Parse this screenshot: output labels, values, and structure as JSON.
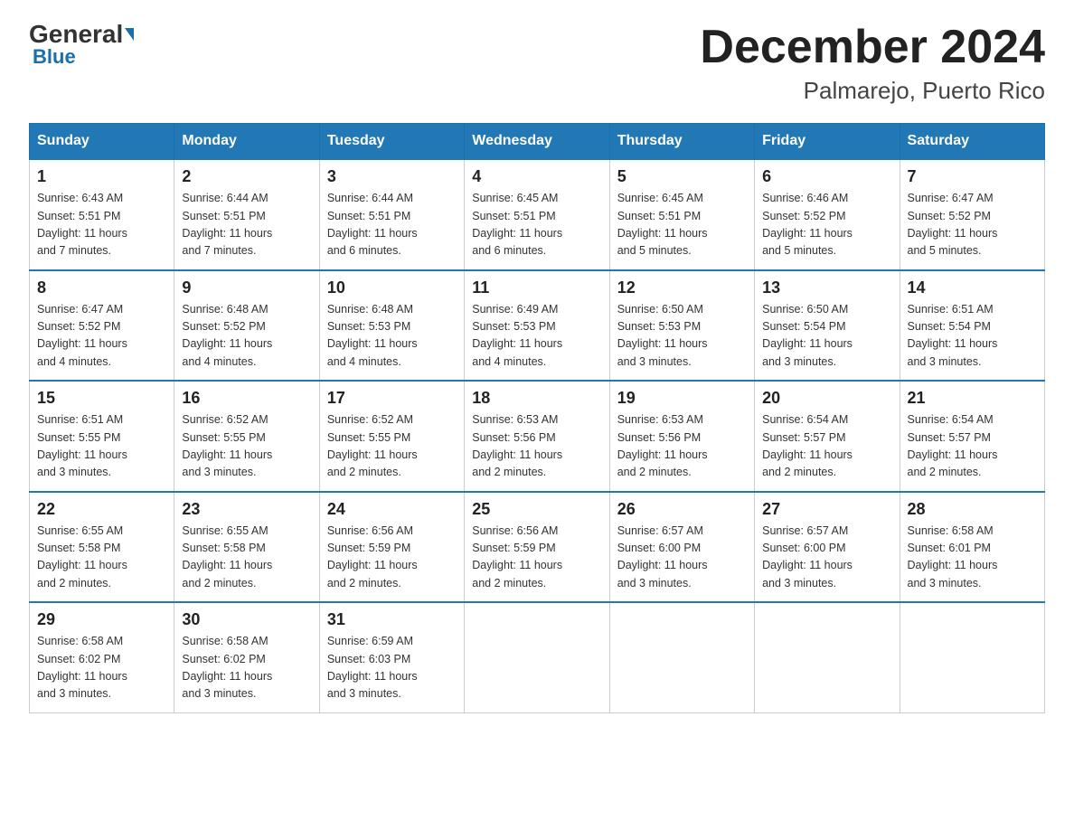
{
  "header": {
    "logo_general": "General",
    "logo_blue": "Blue",
    "month_title": "December 2024",
    "location": "Palmarejo, Puerto Rico"
  },
  "columns": [
    "Sunday",
    "Monday",
    "Tuesday",
    "Wednesday",
    "Thursday",
    "Friday",
    "Saturday"
  ],
  "weeks": [
    [
      {
        "day": "1",
        "sunrise": "6:43 AM",
        "sunset": "5:51 PM",
        "daylight": "11 hours and 7 minutes."
      },
      {
        "day": "2",
        "sunrise": "6:44 AM",
        "sunset": "5:51 PM",
        "daylight": "11 hours and 7 minutes."
      },
      {
        "day": "3",
        "sunrise": "6:44 AM",
        "sunset": "5:51 PM",
        "daylight": "11 hours and 6 minutes."
      },
      {
        "day": "4",
        "sunrise": "6:45 AM",
        "sunset": "5:51 PM",
        "daylight": "11 hours and 6 minutes."
      },
      {
        "day": "5",
        "sunrise": "6:45 AM",
        "sunset": "5:51 PM",
        "daylight": "11 hours and 5 minutes."
      },
      {
        "day": "6",
        "sunrise": "6:46 AM",
        "sunset": "5:52 PM",
        "daylight": "11 hours and 5 minutes."
      },
      {
        "day": "7",
        "sunrise": "6:47 AM",
        "sunset": "5:52 PM",
        "daylight": "11 hours and 5 minutes."
      }
    ],
    [
      {
        "day": "8",
        "sunrise": "6:47 AM",
        "sunset": "5:52 PM",
        "daylight": "11 hours and 4 minutes."
      },
      {
        "day": "9",
        "sunrise": "6:48 AM",
        "sunset": "5:52 PM",
        "daylight": "11 hours and 4 minutes."
      },
      {
        "day": "10",
        "sunrise": "6:48 AM",
        "sunset": "5:53 PM",
        "daylight": "11 hours and 4 minutes."
      },
      {
        "day": "11",
        "sunrise": "6:49 AM",
        "sunset": "5:53 PM",
        "daylight": "11 hours and 4 minutes."
      },
      {
        "day": "12",
        "sunrise": "6:50 AM",
        "sunset": "5:53 PM",
        "daylight": "11 hours and 3 minutes."
      },
      {
        "day": "13",
        "sunrise": "6:50 AM",
        "sunset": "5:54 PM",
        "daylight": "11 hours and 3 minutes."
      },
      {
        "day": "14",
        "sunrise": "6:51 AM",
        "sunset": "5:54 PM",
        "daylight": "11 hours and 3 minutes."
      }
    ],
    [
      {
        "day": "15",
        "sunrise": "6:51 AM",
        "sunset": "5:55 PM",
        "daylight": "11 hours and 3 minutes."
      },
      {
        "day": "16",
        "sunrise": "6:52 AM",
        "sunset": "5:55 PM",
        "daylight": "11 hours and 3 minutes."
      },
      {
        "day": "17",
        "sunrise": "6:52 AM",
        "sunset": "5:55 PM",
        "daylight": "11 hours and 2 minutes."
      },
      {
        "day": "18",
        "sunrise": "6:53 AM",
        "sunset": "5:56 PM",
        "daylight": "11 hours and 2 minutes."
      },
      {
        "day": "19",
        "sunrise": "6:53 AM",
        "sunset": "5:56 PM",
        "daylight": "11 hours and 2 minutes."
      },
      {
        "day": "20",
        "sunrise": "6:54 AM",
        "sunset": "5:57 PM",
        "daylight": "11 hours and 2 minutes."
      },
      {
        "day": "21",
        "sunrise": "6:54 AM",
        "sunset": "5:57 PM",
        "daylight": "11 hours and 2 minutes."
      }
    ],
    [
      {
        "day": "22",
        "sunrise": "6:55 AM",
        "sunset": "5:58 PM",
        "daylight": "11 hours and 2 minutes."
      },
      {
        "day": "23",
        "sunrise": "6:55 AM",
        "sunset": "5:58 PM",
        "daylight": "11 hours and 2 minutes."
      },
      {
        "day": "24",
        "sunrise": "6:56 AM",
        "sunset": "5:59 PM",
        "daylight": "11 hours and 2 minutes."
      },
      {
        "day": "25",
        "sunrise": "6:56 AM",
        "sunset": "5:59 PM",
        "daylight": "11 hours and 2 minutes."
      },
      {
        "day": "26",
        "sunrise": "6:57 AM",
        "sunset": "6:00 PM",
        "daylight": "11 hours and 3 minutes."
      },
      {
        "day": "27",
        "sunrise": "6:57 AM",
        "sunset": "6:00 PM",
        "daylight": "11 hours and 3 minutes."
      },
      {
        "day": "28",
        "sunrise": "6:58 AM",
        "sunset": "6:01 PM",
        "daylight": "11 hours and 3 minutes."
      }
    ],
    [
      {
        "day": "29",
        "sunrise": "6:58 AM",
        "sunset": "6:02 PM",
        "daylight": "11 hours and 3 minutes."
      },
      {
        "day": "30",
        "sunrise": "6:58 AM",
        "sunset": "6:02 PM",
        "daylight": "11 hours and 3 minutes."
      },
      {
        "day": "31",
        "sunrise": "6:59 AM",
        "sunset": "6:03 PM",
        "daylight": "11 hours and 3 minutes."
      },
      null,
      null,
      null,
      null
    ]
  ],
  "labels": {
    "sunrise": "Sunrise:",
    "sunset": "Sunset:",
    "daylight": "Daylight:"
  }
}
